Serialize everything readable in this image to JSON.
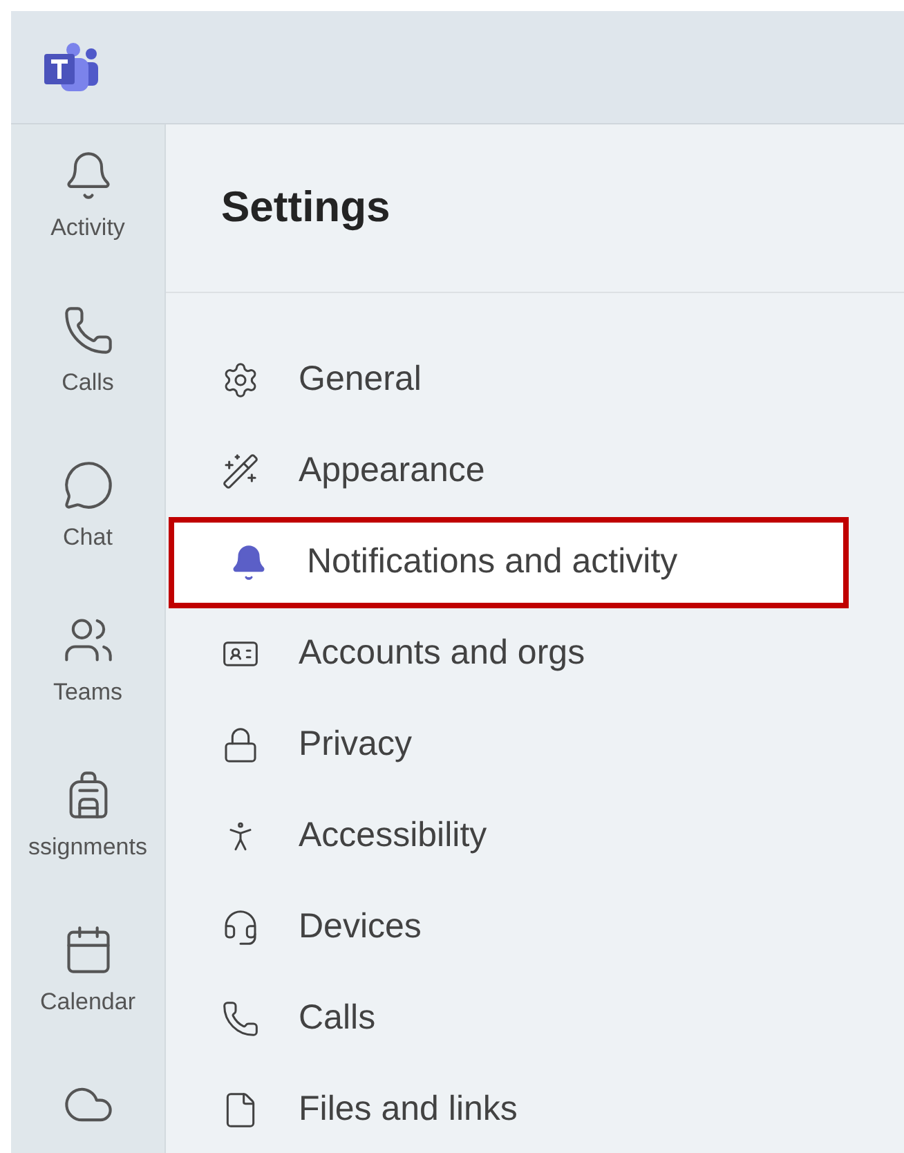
{
  "rail": {
    "items": [
      {
        "label": "Activity",
        "selected": false
      },
      {
        "label": "Calls",
        "selected": false
      },
      {
        "label": "Chat",
        "selected": false
      },
      {
        "label": "Teams",
        "selected": false
      },
      {
        "label": "ssignments",
        "selected": false
      },
      {
        "label": "Calendar",
        "selected": false
      },
      {
        "selected": false
      }
    ]
  },
  "settings": {
    "title": "Settings",
    "items": [
      {
        "label": "General",
        "selected": false
      },
      {
        "label": "Appearance",
        "selected": false
      },
      {
        "label": "Notifications and activity",
        "selected": true
      },
      {
        "label": "Accounts and orgs",
        "selected": false
      },
      {
        "label": "Privacy",
        "selected": false
      },
      {
        "label": "Accessibility",
        "selected": false
      },
      {
        "label": "Devices",
        "selected": false
      },
      {
        "label": "Calls",
        "selected": false
      },
      {
        "label": "Files and links",
        "selected": false
      }
    ]
  }
}
